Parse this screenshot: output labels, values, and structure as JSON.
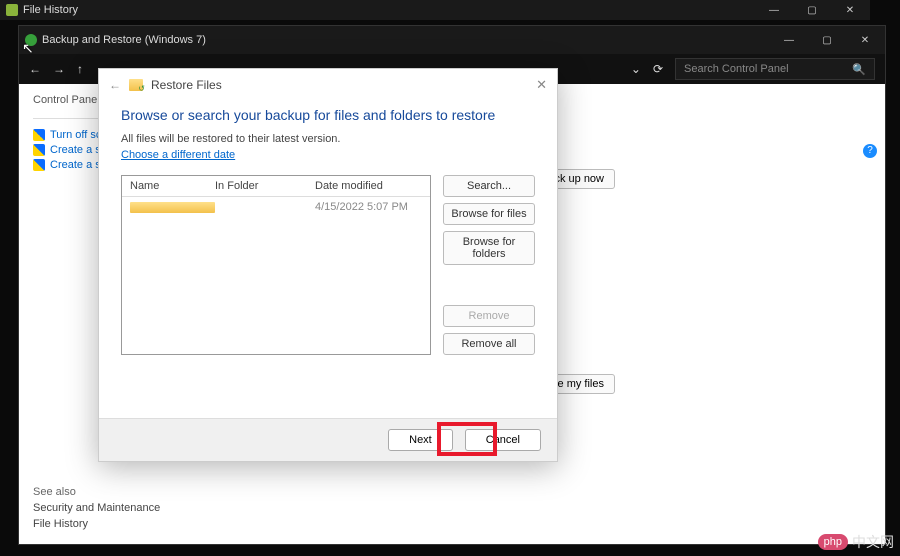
{
  "file_history_window": {
    "title": "File History"
  },
  "backup_window": {
    "title": "Backup and Restore (Windows 7)",
    "search_placeholder": "Search Control Panel"
  },
  "control_panel": {
    "breadcrumb": "Control Panel",
    "links": {
      "turn_off": "Turn off sched",
      "create_disc": "Create a syste",
      "create_image": "Create a syste"
    },
    "see_also": {
      "heading": "See also",
      "security": "Security and Maintenance",
      "file_history": "File History"
    }
  },
  "right_pane": {
    "backup_now": "Back up now",
    "restore_files": "store my files"
  },
  "dialog": {
    "title": "Restore Files",
    "heading": "Browse or search your backup for files and folders to restore",
    "subtext": "All files will be restored to their latest version.",
    "choose_date": "Choose a different date",
    "columns": {
      "name": "Name",
      "folder": "In Folder",
      "modified": "Date modified"
    },
    "row_date": "4/15/2022 5:07 PM",
    "buttons": {
      "search": "Search...",
      "browse_files": "Browse for files",
      "browse_folders": "Browse for folders",
      "remove": "Remove",
      "remove_all": "Remove all",
      "next": "Next",
      "cancel": "Cancel"
    }
  },
  "watermark": {
    "badge": "php",
    "text": "中文网"
  }
}
